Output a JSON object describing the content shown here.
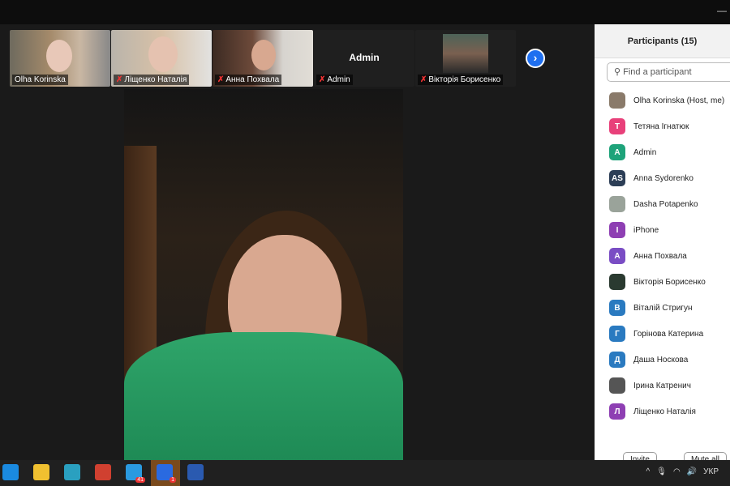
{
  "window": {
    "minimize_icon": "minimize-icon"
  },
  "thumbnails": [
    {
      "name": "Olha Korinska",
      "muted": false
    },
    {
      "name": "Ліщенко Наталія",
      "muted": true
    },
    {
      "name": "Анна Похвала",
      "muted": true
    },
    {
      "name": "Admin",
      "muted": true,
      "center_name": "Admin"
    },
    {
      "name": "Вікторія Борисенко",
      "muted": true
    }
  ],
  "next_icon": "›",
  "participants": {
    "title": "Participants (15)",
    "search_placeholder": "Find a participant",
    "items": [
      {
        "name": "Olha Korinska (Host, me)",
        "initials": "",
        "color": "#8a7a6a"
      },
      {
        "name": "Тетяна Ігнатюк",
        "initials": "Т",
        "color": "#e8407a"
      },
      {
        "name": "Admin",
        "initials": "A",
        "color": "#1ea37a"
      },
      {
        "name": "Anna Sydorenko",
        "initials": "AS",
        "color": "#2c3e56"
      },
      {
        "name": "Dasha Potapenko",
        "initials": "",
        "color": "#9aa39a"
      },
      {
        "name": "iPhone",
        "initials": "I",
        "color": "#8e3fb3"
      },
      {
        "name": "Анна Похвала",
        "initials": "A",
        "color": "#7a4dc4"
      },
      {
        "name": "Вікторія Борисенко",
        "initials": "",
        "color": "#2a3a30"
      },
      {
        "name": "Віталій Стригун",
        "initials": "B",
        "color": "#2a7ac0"
      },
      {
        "name": "Горінова Катерина",
        "initials": "Г",
        "color": "#2a7ac0"
      },
      {
        "name": "Даша Носкова",
        "initials": "Д",
        "color": "#2a7ac0"
      },
      {
        "name": "Ірина Катренич",
        "initials": "",
        "color": "#555"
      },
      {
        "name": "Ліщенко Наталія",
        "initials": "Л",
        "color": "#8e3fb3"
      }
    ],
    "invite_label": "Invite",
    "mute_all_label": "Mute all"
  },
  "taskbar": {
    "apps": [
      {
        "name": "mail",
        "color": "#1a8ae0"
      },
      {
        "name": "file-explorer",
        "color": "#f0c030"
      },
      {
        "name": "edge",
        "color": "#2aa0c0"
      },
      {
        "name": "chrome",
        "color": "#d04030"
      },
      {
        "name": "telegram",
        "color": "#2a9ae0",
        "badge": "41"
      },
      {
        "name": "zoom",
        "color": "#2a6ae0",
        "badge": "1"
      },
      {
        "name": "word",
        "color": "#2a5ab0"
      }
    ],
    "language": "УКР"
  }
}
